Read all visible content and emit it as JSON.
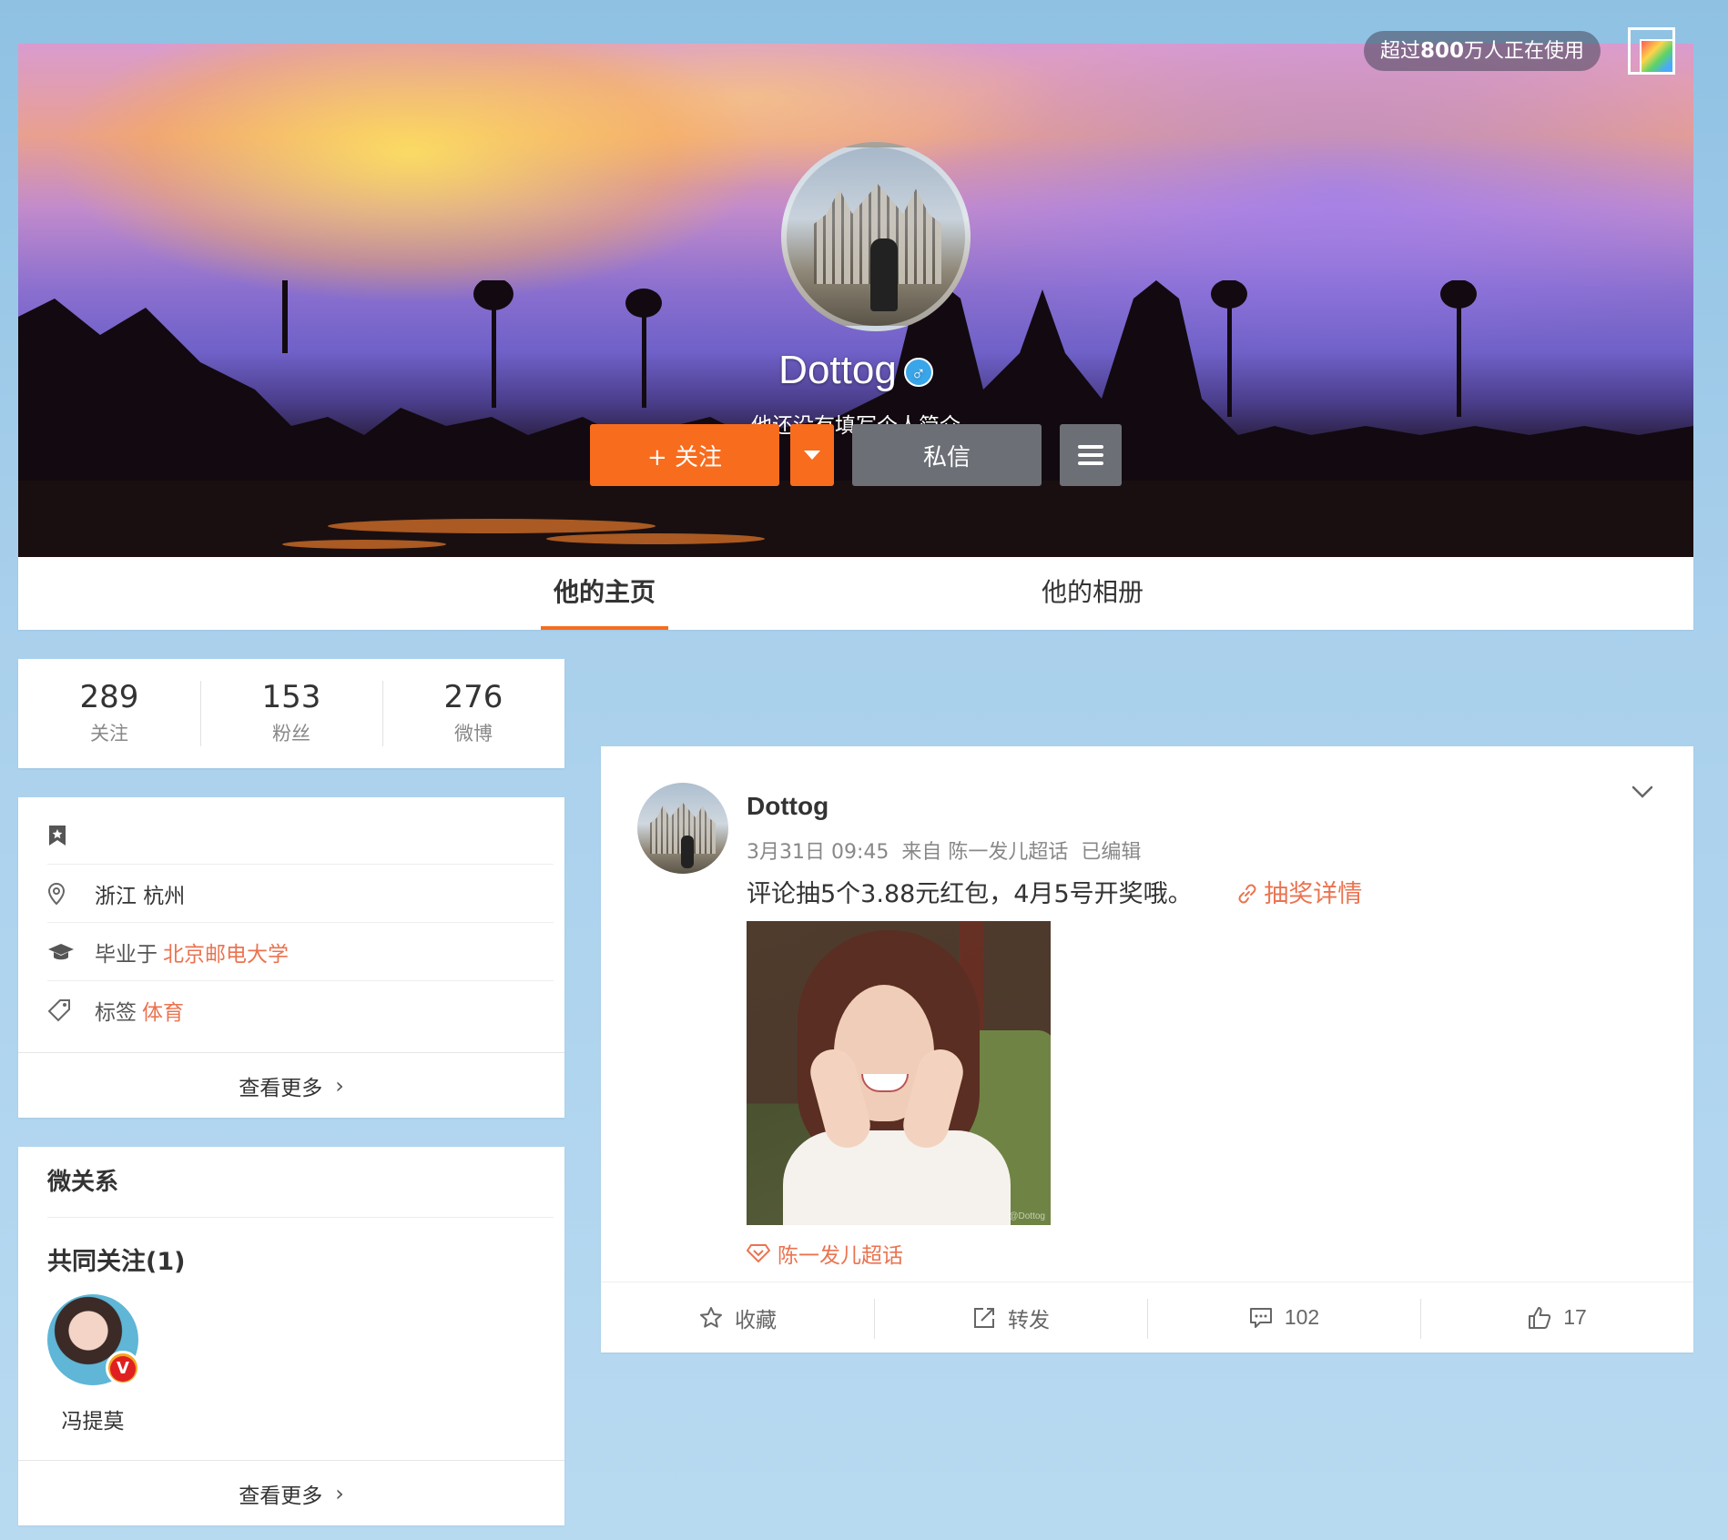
{
  "header": {
    "users_badge_prefix": "超过",
    "users_badge_count": "800",
    "users_badge_suffix": "万人正在使用",
    "username": "Dottog",
    "gender_symbol": "♂",
    "bio": "他还没有填写个人简介",
    "follow_label": "+ 关注",
    "message_label": "私信"
  },
  "tabs": [
    {
      "label": "他的主页",
      "active": true
    },
    {
      "label": "他的相册",
      "active": false
    }
  ],
  "stats": [
    {
      "value": "289",
      "label": "关注"
    },
    {
      "value": "153",
      "label": "粉丝"
    },
    {
      "value": "276",
      "label": "微博"
    }
  ],
  "info": {
    "location": "浙江 杭州",
    "education_prefix": "毕业于",
    "education_school": "北京邮电大学",
    "tags_prefix": "标签",
    "tags_value": "体育",
    "more_label": "查看更多"
  },
  "relation": {
    "title": "微关系",
    "mutual_title": "共同关注(1)",
    "mutual_user_name": "冯提莫",
    "badge_letter": "V",
    "more_label": "查看更多"
  },
  "post": {
    "author": "Dottog",
    "date": "3月31日 09:45",
    "source": "来自 陈一发儿超话",
    "edited": "已编辑",
    "text": "评论抽5个3.88元红包，4月5号开奖哦。",
    "lottery_link": "抽奖详情",
    "image_watermark": "@Dottog",
    "supertopic": "陈一发儿超话",
    "actions": {
      "favorite_label": "收藏",
      "repost_label": "转发",
      "comment_count": "102",
      "like_count": "17"
    }
  },
  "colors": {
    "accent": "#f86c1d",
    "link": "#eb7350",
    "dark_button": "#6c6f76"
  }
}
